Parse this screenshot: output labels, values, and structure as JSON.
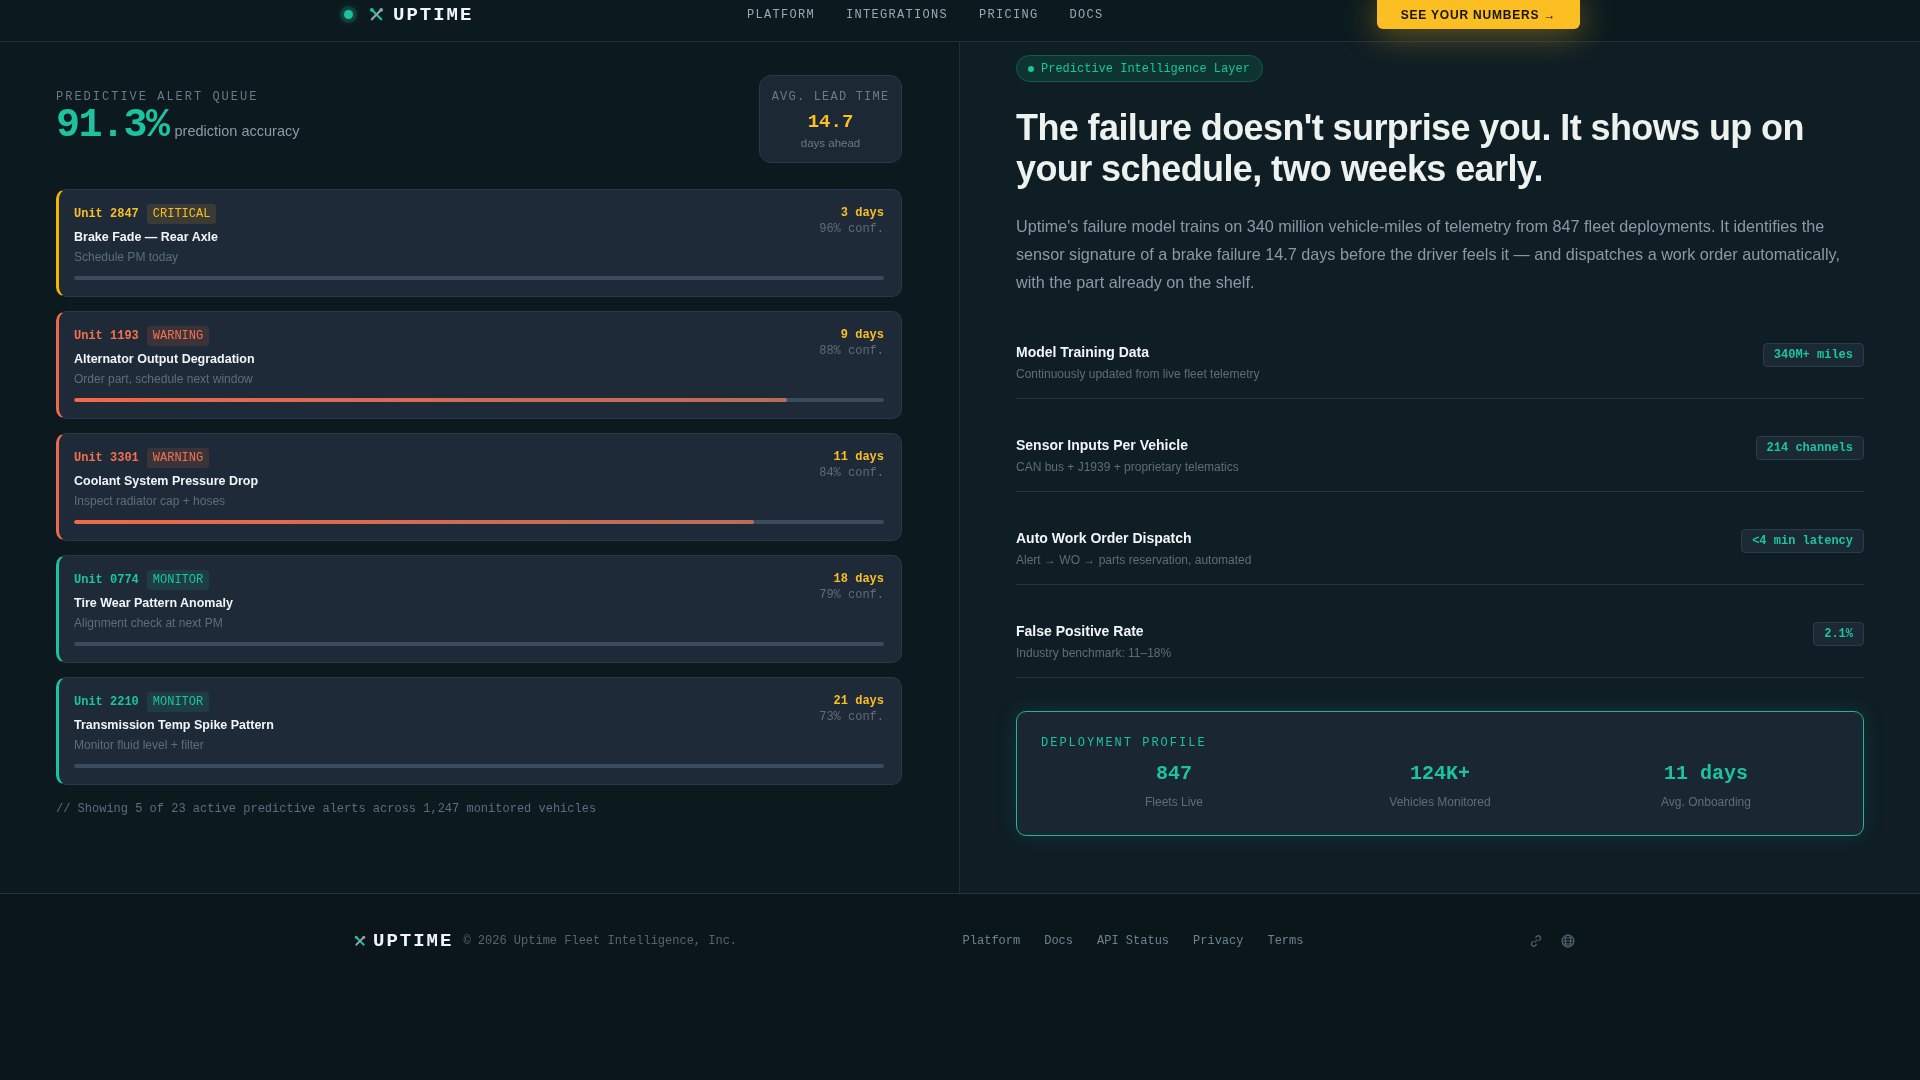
{
  "nav": {
    "brand": "UPTIME",
    "links": [
      "PLATFORM",
      "INTEGRATIONS",
      "PRICING",
      "DOCS"
    ],
    "cta": "SEE YOUR NUMBERS →"
  },
  "alert_queue": {
    "label": "PREDICTIVE ALERT QUEUE",
    "accuracy": "91.3%",
    "accuracy_caption": "prediction accuracy",
    "lead_time": {
      "label": "AVG. LEAD TIME",
      "value": "14.7",
      "unit": "days ahead"
    },
    "alerts": [
      {
        "kind": "critical",
        "unit": "Unit 2847",
        "badge": "CRITICAL",
        "title": "Brake Fade — Rear Axle",
        "action": "Schedule PM today",
        "eta": "3 days",
        "confidence": "96% conf."
      },
      {
        "kind": "warning",
        "unit": "Unit 1193",
        "badge": "WARNING",
        "title": "Alternator Output Degradation",
        "action": "Order part, schedule next window",
        "eta": "9 days",
        "confidence": "88% conf.",
        "level": 0.88
      },
      {
        "kind": "warning",
        "unit": "Unit 3301",
        "badge": "WARNING",
        "title": "Coolant System Pressure Drop",
        "action": "Inspect radiator cap + hoses",
        "eta": "11 days",
        "confidence": "84% conf.",
        "level": 0.84
      },
      {
        "kind": "monitor",
        "unit": "Unit 0774",
        "badge": "MONITOR",
        "title": "Tire Wear Pattern Anomaly",
        "action": "Alignment check at next PM",
        "eta": "18 days",
        "confidence": "79% conf."
      },
      {
        "kind": "monitor",
        "unit": "Unit 2210",
        "badge": "MONITOR",
        "title": "Transmission Temp Spike Pattern",
        "action": "Monitor fluid level + filter",
        "eta": "21 days",
        "confidence": "73% conf."
      }
    ],
    "note": "// Showing 5 of 23 active predictive alerts across 1,247 monitored vehicles"
  },
  "hero": {
    "tag": "Predictive Intelligence Layer",
    "headline": "The failure doesn't surprise you. It shows up on your schedule, two weeks early.",
    "body": "Uptime's failure model trains on 340 million vehicle-miles of telemetry from 847 fleet deployments. It identifies the sensor signature of a brake failure 14.7 days before the driver feels it — and dispatches a work order automatically, with the part already on the shelf."
  },
  "metrics": [
    {
      "title": "Model Training Data",
      "subtitle": "Continuously updated from live fleet telemetry",
      "value": "340M+ miles"
    },
    {
      "title": "Sensor Inputs Per Vehicle",
      "subtitle": "CAN bus + J1939 + proprietary telematics",
      "value": "214 channels"
    },
    {
      "title": "Auto Work Order Dispatch",
      "subtitle": "Alert → WO → parts reservation, automated",
      "value": "<4 min latency"
    },
    {
      "title": "False Positive Rate",
      "subtitle": "Industry benchmark: 11–18%",
      "value": "2.1%"
    }
  ],
  "deployment_profile": {
    "label": "DEPLOYMENT PROFILE",
    "stats": [
      {
        "value": "847",
        "label": "Fleets Live"
      },
      {
        "value": "124K+",
        "label": "Vehicles Monitored"
      },
      {
        "value": "11 days",
        "label": "Avg. Onboarding"
      }
    ]
  },
  "footer": {
    "brand": "UPTIME",
    "copyright": "© 2026 Uptime Fleet Intelligence, Inc.",
    "links": [
      "Platform",
      "Docs",
      "API Status",
      "Privacy",
      "Terms"
    ]
  }
}
